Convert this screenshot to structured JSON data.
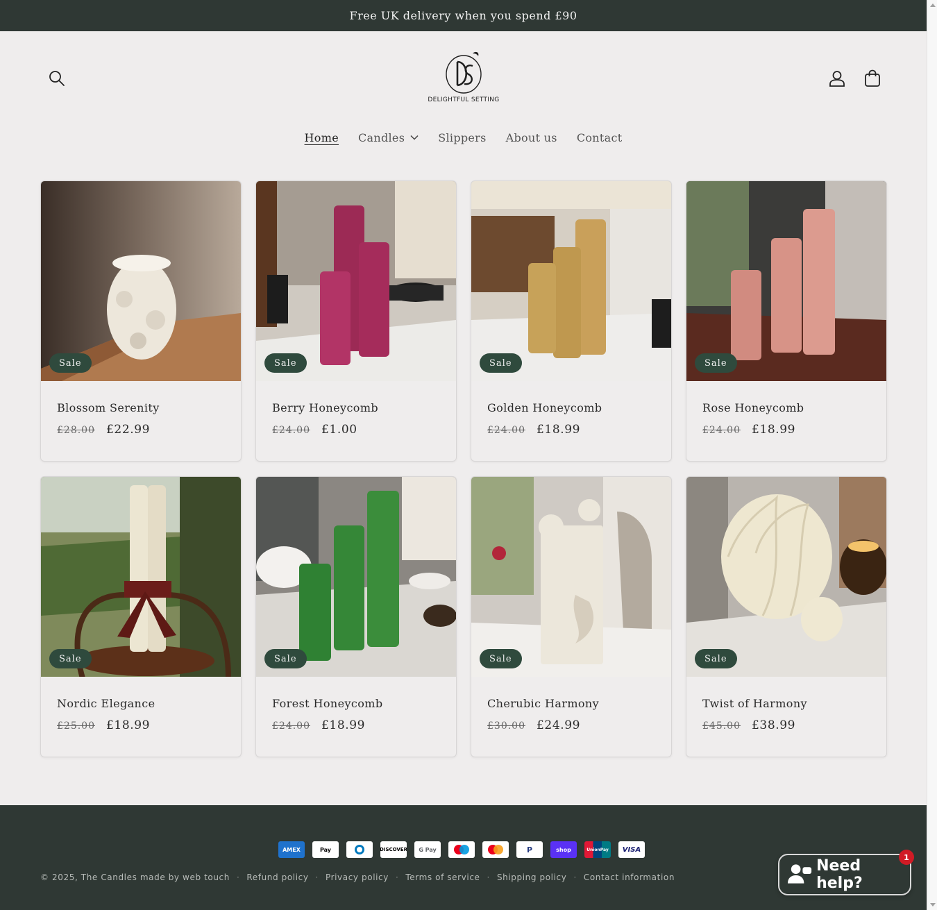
{
  "announcement": {
    "text": "Free UK delivery when you spend £90"
  },
  "header": {
    "logo_text": "DELIGHTFUL SETTING",
    "logo_monogram": "DS"
  },
  "nav": {
    "items": [
      {
        "label": "Home",
        "active": true
      },
      {
        "label": "Candles",
        "has_dropdown": true
      },
      {
        "label": "Slippers"
      },
      {
        "label": "About us"
      },
      {
        "label": "Contact"
      }
    ]
  },
  "products": [
    {
      "title": "Blossom Serenity",
      "old_price": "£28.00",
      "price": "£22.99",
      "badge": "Sale"
    },
    {
      "title": "Berry Honeycomb",
      "old_price": "£24.00",
      "price": "£1.00",
      "badge": "Sale"
    },
    {
      "title": "Golden Honeycomb",
      "old_price": "£24.00",
      "price": "£18.99",
      "badge": "Sale"
    },
    {
      "title": "Rose Honeycomb",
      "old_price": "£24.00",
      "price": "£18.99",
      "badge": "Sale"
    },
    {
      "title": "Nordic Elegance",
      "old_price": "£25.00",
      "price": "£18.99",
      "badge": "Sale"
    },
    {
      "title": "Forest Honeycomb",
      "old_price": "£24.00",
      "price": "£18.99",
      "badge": "Sale"
    },
    {
      "title": "Cherubic Harmony",
      "old_price": "£30.00",
      "price": "£24.99",
      "badge": "Sale"
    },
    {
      "title": "Twist of Harmony",
      "old_price": "£45.00",
      "price": "£38.99",
      "badge": "Sale"
    }
  ],
  "footer": {
    "payments": [
      "American Express",
      "Apple Pay",
      "Diners Club",
      "Discover",
      "Google Pay",
      "Maestro",
      "Mastercard",
      "PayPal",
      "Shop Pay",
      "UnionPay",
      "Visa"
    ],
    "copyright": "© 2025, The Candles made by web touch",
    "links": [
      "Refund policy",
      "Privacy policy",
      "Terms of service",
      "Shipping policy",
      "Contact information"
    ]
  },
  "chat": {
    "label": "Need help?",
    "count": "1"
  },
  "colors": {
    "dark": "#2f3834",
    "badge": "#2f4a3d",
    "background": "#efeded"
  }
}
